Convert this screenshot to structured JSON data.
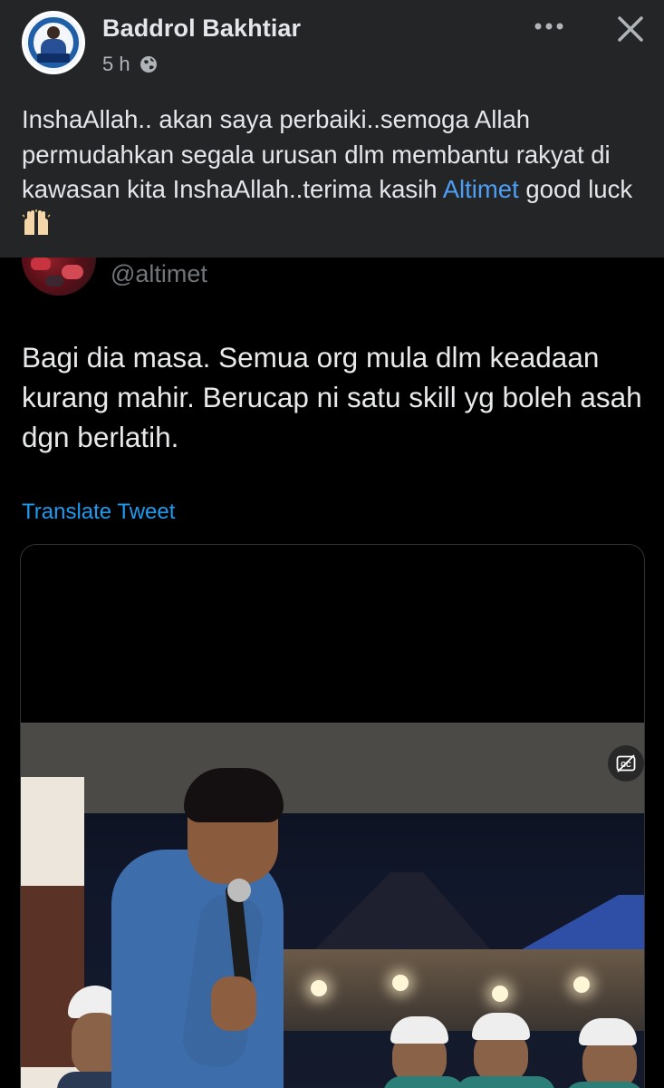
{
  "post": {
    "author_name": "Baddrol Bakhtiar",
    "time_ago": "5 h",
    "privacy_icon": "globe-icon",
    "more_icon": "more-horizontal-icon",
    "close_icon": "close-icon",
    "caption_before_mention": "InshaAllah.. akan saya perbaiki..semoga Allah permudahkan segala urusan dlm membantu rakyat di kawasan kita InshaAllah..terima kasih ",
    "caption_mention": "Altimet",
    "caption_after_mention": " good luck",
    "caption_emoji": "raising-hands-emoji",
    "avatar_icon": "page-avatar"
  },
  "tweet": {
    "handle": "@altimet",
    "text": "Bagi dia masa. Semua org mula dlm keadaan kurang mahir. Berucap ni satu skill yg boleh asah dgn berlatih.",
    "translate_link": "Translate Tweet",
    "video_caption_icon": "closed-captions-off-icon"
  },
  "colors": {
    "fb_header_bg": "#242526",
    "fb_text": "#e4e6eb",
    "fb_secondary": "#b0b3b8",
    "mention": "#4d9ef5",
    "tweet_bg": "#000000",
    "tweet_text": "#e7e9ea",
    "tweet_secondary": "#71767b",
    "twitter_blue": "#1d9bf0"
  }
}
